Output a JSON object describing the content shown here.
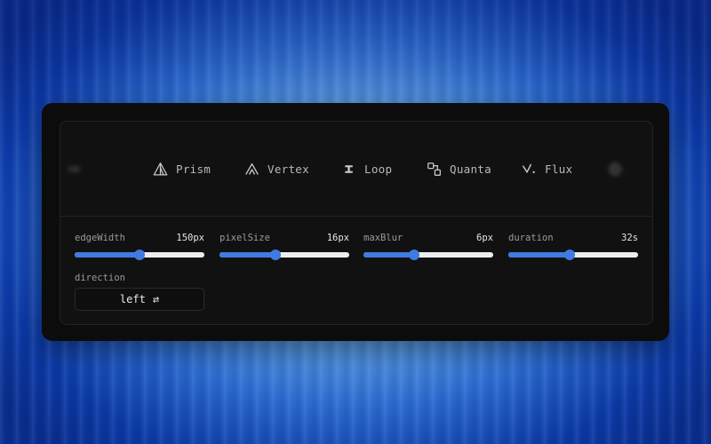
{
  "marquee": {
    "logos": [
      {
        "label": "",
        "icon": "blurred-logo-icon",
        "blurred": true
      },
      {
        "label": "Prism",
        "icon": "prism-icon",
        "blurred": false
      },
      {
        "label": "Vertex",
        "icon": "vertex-icon",
        "blurred": false
      },
      {
        "label": "Loop",
        "icon": "loop-icon",
        "blurred": false
      },
      {
        "label": "Quanta",
        "icon": "quanta-icon",
        "blurred": false
      },
      {
        "label": "Flux",
        "icon": "flux-icon",
        "blurred": false
      },
      {
        "label": "",
        "icon": "globe-icon",
        "blurred": true
      }
    ]
  },
  "controls": [
    {
      "name": "edgeWidth",
      "value": "150px",
      "fraction": 0.5
    },
    {
      "name": "pixelSize",
      "value": "16px",
      "fraction": 0.43
    },
    {
      "name": "maxBlur",
      "value": "6px",
      "fraction": 0.39
    },
    {
      "name": "duration",
      "value": "32s",
      "fraction": 0.47
    }
  ],
  "direction": {
    "label": "direction",
    "value": "left",
    "toggle_glyph": "⇄"
  },
  "colors": {
    "accent": "#3f7be0",
    "panel": "#0c0c0d",
    "text": "#b9b9bd"
  }
}
